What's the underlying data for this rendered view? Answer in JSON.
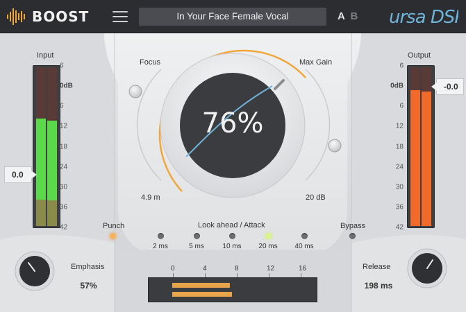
{
  "header": {
    "product": "BOOST",
    "preset_name": "In Your Face Female Vocal",
    "ab_a": "A",
    "ab_b": "B",
    "brand": "ursa DSP"
  },
  "input_meter": {
    "title": "Input",
    "value": "0.0",
    "scale": [
      "6",
      "0dB",
      "6",
      "12",
      "18",
      "24",
      "30",
      "36",
      "42"
    ],
    "level_left": 0.67,
    "level_right": 0.66
  },
  "output_meter": {
    "title": "Output",
    "value": "-0.0",
    "scale": [
      "6",
      "0dB",
      "6",
      "12",
      "18",
      "24",
      "30",
      "36",
      "42"
    ],
    "level_left": 0.85,
    "level_right": 0.84
  },
  "main_knob": {
    "value": "76%",
    "amount": 0.76
  },
  "focus": {
    "label": "Focus",
    "value": "4.9 m"
  },
  "max_gain": {
    "label": "Max Gain",
    "value": "20 dB"
  },
  "punch": {
    "label": "Punch",
    "on": true
  },
  "bypass": {
    "label": "Bypass",
    "on": false
  },
  "lookahead": {
    "title": "Look ahead / Attack",
    "options": [
      "2 ms",
      "5 ms",
      "10 ms",
      "20 ms",
      "40 ms"
    ],
    "selected": "20 ms"
  },
  "emphasis": {
    "label": "Emphasis",
    "value": "57%",
    "amount": 0.57
  },
  "release": {
    "label": "Release",
    "value": "198 ms",
    "amount": 0.65
  },
  "gr_meter": {
    "scale": [
      "0",
      "4",
      "8",
      "12",
      "16"
    ],
    "level_top": 0.45,
    "level_bottom": 0.47
  },
  "colors": {
    "accent": "#f2a63a",
    "meter_green": "#5bd94a",
    "meter_orange": "#f26a2a",
    "trace_blue": "#6fb4da"
  }
}
